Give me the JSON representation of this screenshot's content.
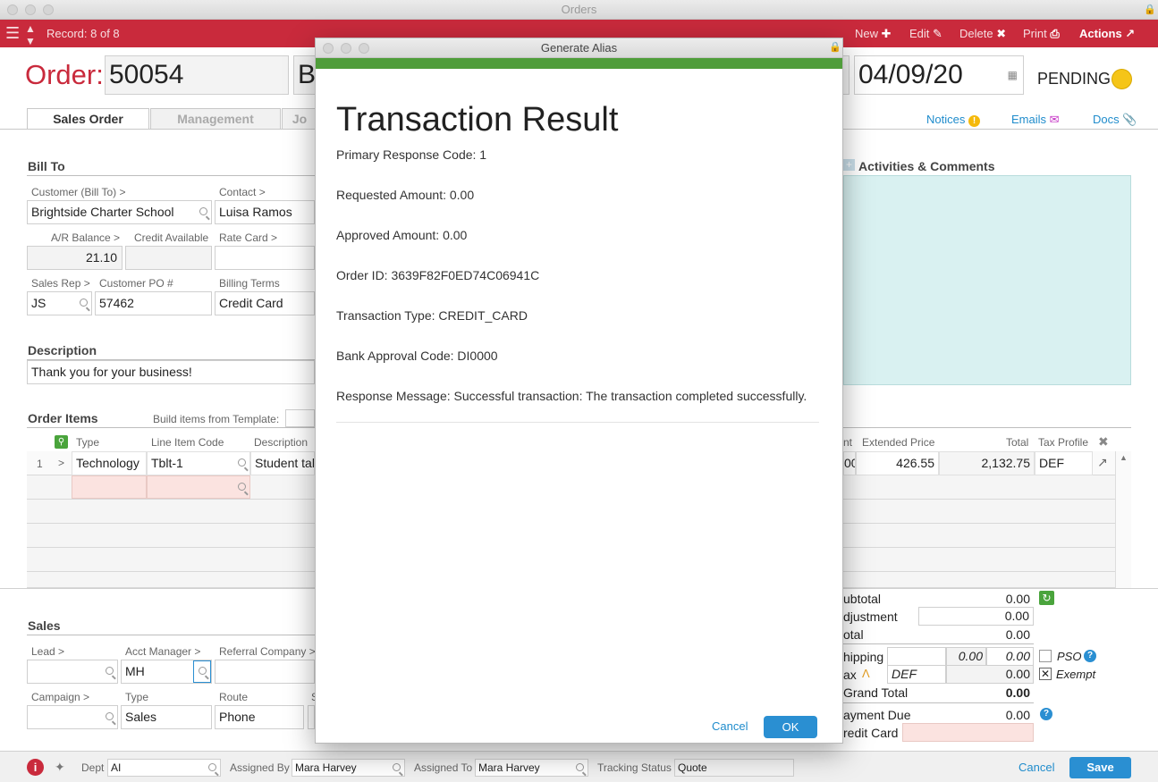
{
  "window": {
    "title": "Orders"
  },
  "toolbar": {
    "record": "Record: 8 of 8",
    "new": "New",
    "edit": "Edit",
    "delete": "Delete",
    "print": "Print",
    "actions": "Actions"
  },
  "header": {
    "order_label": "Order:",
    "order_number": "50054",
    "customer_fragment": "B",
    "date": "04/09/20",
    "status": "PENDING"
  },
  "tabs": [
    {
      "label": "Sales Order"
    },
    {
      "label": "Management"
    },
    {
      "label": "Jo"
    }
  ],
  "right_links": {
    "notices": "Notices",
    "emails": "Emails",
    "docs": "Docs"
  },
  "bill_to": {
    "heading": "Bill To",
    "customer_label": "Customer (Bill To) >",
    "customer": "Brightside Charter School",
    "contact_label": "Contact >",
    "contact": "Luisa Ramos",
    "ar_label": "A/R Balance >",
    "ar_balance": "21.10",
    "credit_label": "Credit Available",
    "rate_label": "Rate Card >",
    "rep_label": "Sales Rep >",
    "rep": "JS",
    "po_label": "Customer PO #",
    "po": "57462",
    "terms_label": "Billing Terms",
    "terms": "Credit Card"
  },
  "description": {
    "heading": "Description",
    "text": "Thank you for your business!"
  },
  "activities": {
    "heading": "Activities & Comments"
  },
  "order_items": {
    "heading": "Order Items",
    "template_label": "Build items from Template:",
    "columns": {
      "type": "Type",
      "code": "Line Item Code",
      "desc": "Description",
      "unit_frag": "nt",
      "ext": "Extended Price",
      "total": "Total",
      "tax": "Tax Profile"
    },
    "rows": [
      {
        "num": "1",
        "type": "Technology",
        "code": "Tblt-1",
        "desc": "Student tab",
        "unit_frag": "00",
        "ext": "426.55",
        "total": "2,132.75",
        "tax": "DEF"
      }
    ]
  },
  "sales": {
    "heading": "Sales",
    "lead_label": "Lead >",
    "acct_label": "Acct Manager >",
    "acct": "MH",
    "referral_label": "Referral Company >",
    "campaign_label": "Campaign >",
    "type_label": "Type",
    "type": "Sales",
    "route_label": "Route",
    "route": "Phone",
    "s_frag": "S"
  },
  "totals": {
    "subtotal_label": "ubtotal",
    "subtotal": "0.00",
    "adjustment_label": "djustment",
    "adjustment": "0.00",
    "total_label": "otal",
    "total": "0.00",
    "shipping_label": "hipping",
    "shipping_cost": "0.00",
    "shipping": "0.00",
    "pso": "PSO",
    "tax_label": "ax",
    "tax_profile": "DEF",
    "tax": "0.00",
    "exempt": "Exempt",
    "grand_label": "Grand Total",
    "grand": "0.00",
    "payment_label": "ayment Due",
    "payment": "0.00",
    "card_label": "redit Card"
  },
  "footer": {
    "dept_label": "Dept",
    "dept": "AI",
    "assigned_by_label": "Assigned By",
    "assigned_by": "Mara Harvey",
    "assigned_to_label": "Assigned To",
    "assigned_to": "Mara Harvey",
    "tracking_label": "Tracking Status",
    "tracking": "Quote",
    "cancel": "Cancel",
    "save": "Save"
  },
  "modal": {
    "title": "Generate Alias",
    "heading": "Transaction Result",
    "lines": [
      "Primary Response Code: 1",
      "Requested Amount: 0.00",
      "Approved Amount: 0.00",
      "Order ID: 3639F82F0ED74C06941C",
      "Transaction Type: CREDIT_CARD",
      "Bank Approval Code: DI0000",
      "Response Message: Successful transaction: The transaction completed successfully."
    ],
    "cancel": "Cancel",
    "ok": "OK"
  },
  "colors": {
    "toolbar": "#c92a3c",
    "accent": "#2a8fd2",
    "modal_bar": "#4f9d3a",
    "status_dot": "#f5c518"
  }
}
